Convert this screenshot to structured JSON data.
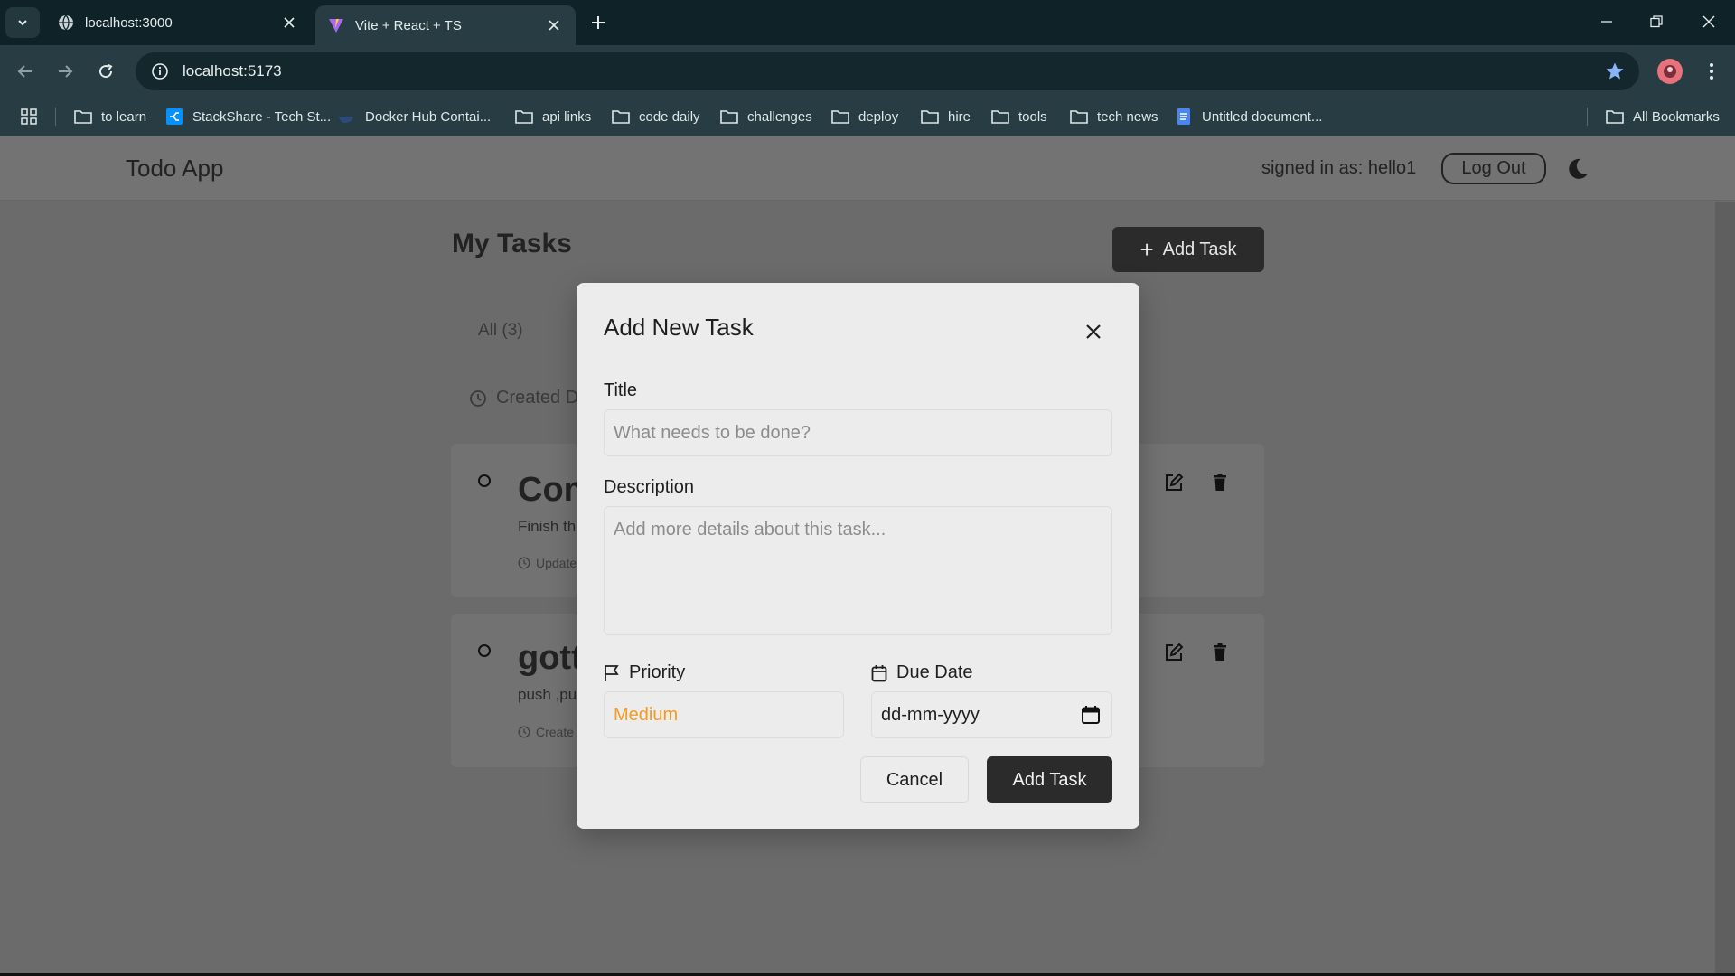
{
  "browser": {
    "tabs": [
      {
        "title": "localhost:3000",
        "active": false
      },
      {
        "title": "Vite + React + TS",
        "active": true
      }
    ],
    "url": "localhost:5173",
    "bookmarks": [
      {
        "label": "to learn",
        "icon": "folder-icon"
      },
      {
        "label": "StackShare - Tech St...",
        "icon": "stackshare-icon"
      },
      {
        "label": "Docker Hub Contai...",
        "icon": "docker-icon"
      },
      {
        "label": "api links",
        "icon": "folder-icon"
      },
      {
        "label": "code daily",
        "icon": "folder-icon"
      },
      {
        "label": "challenges",
        "icon": "folder-icon"
      },
      {
        "label": "deploy",
        "icon": "folder-icon"
      },
      {
        "label": "hire",
        "icon": "folder-icon"
      },
      {
        "label": "tools",
        "icon": "folder-icon"
      },
      {
        "label": "tech news",
        "icon": "folder-icon"
      },
      {
        "label": "Untitled document...",
        "icon": "docs-icon"
      }
    ],
    "all_bookmarks": "All Bookmarks"
  },
  "app": {
    "title": "Todo App",
    "signed_in": "signed in as: hello1",
    "logout": "Log Out"
  },
  "main": {
    "title": "My Tasks",
    "add_task": "Add Task",
    "filter_all": "All (3)",
    "sort_label": "Created D",
    "tasks": [
      {
        "title": "Com",
        "description": "Finish th",
        "meta": "Update"
      },
      {
        "title": "gott",
        "description": "push ,pu",
        "meta": "Create"
      }
    ]
  },
  "modal": {
    "title": "Add New Task",
    "title_label": "Title",
    "title_placeholder": "What needs to be done?",
    "description_label": "Description",
    "description_placeholder": "Add more details about this task...",
    "priority_label": "Priority",
    "priority_value": "Medium",
    "due_label": "Due Date",
    "due_placeholder": "dd-mm-yyyy",
    "cancel": "Cancel",
    "submit": "Add Task"
  },
  "colors": {
    "priority_medium": "#f29b23",
    "tab_strip": "#0f2227",
    "toolbar": "#273d43",
    "overlay": "#6b6b6b",
    "modal_bg": "#ececec",
    "primary_btn": "#2b2b2b"
  }
}
